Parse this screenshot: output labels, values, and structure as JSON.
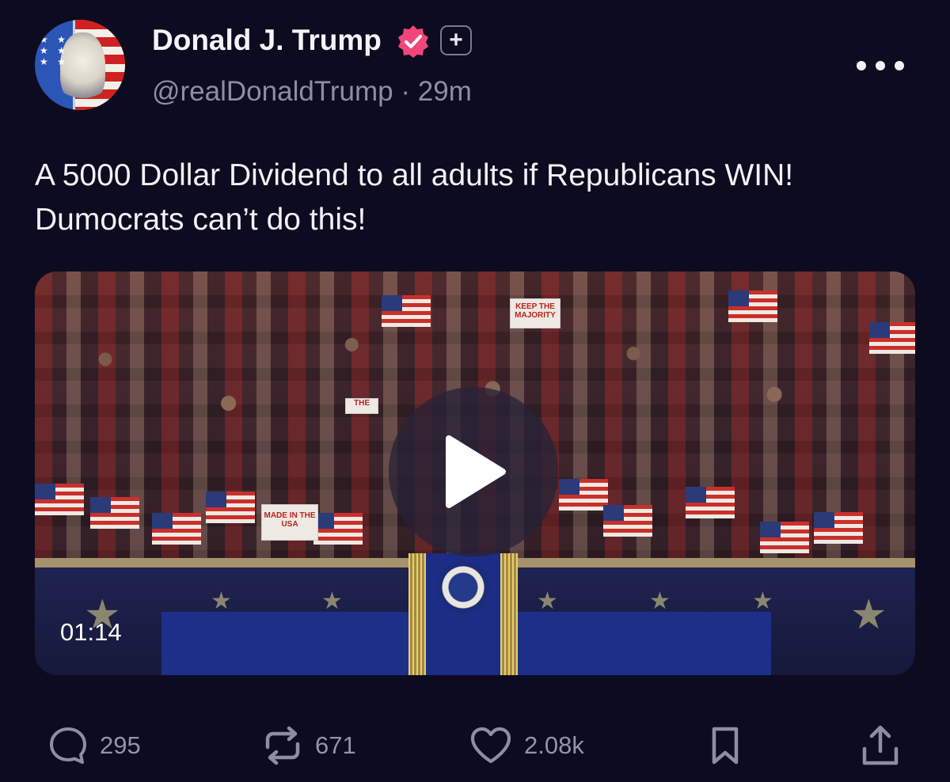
{
  "author": {
    "display_name": "Donald J. Trump",
    "handle": "@realDonaldTrump",
    "separator": "·",
    "time_ago": "29m",
    "avatar_icon": "avatar-image",
    "verified_icon": "verified-badge-icon",
    "verified_color": "#f0467a",
    "plus_badge_label": "+"
  },
  "post": {
    "text": "A 5000 Dollar Dividend to all adults if Republicans WIN! Dumocrats can’t do this!"
  },
  "video": {
    "duration": "01:14",
    "signs": [
      "KEEP THE MAJORITY",
      "MADE IN THE USA",
      "THE"
    ]
  },
  "actions": {
    "replies": "295",
    "reposts": "671",
    "likes": "2.08k",
    "icons": [
      "reply-icon",
      "repost-icon",
      "like-icon",
      "bookmark-icon",
      "share-icon"
    ]
  },
  "colors": {
    "background": "#0d0b1f",
    "text": "#f2f1f6",
    "muted": "#8f8da3"
  }
}
